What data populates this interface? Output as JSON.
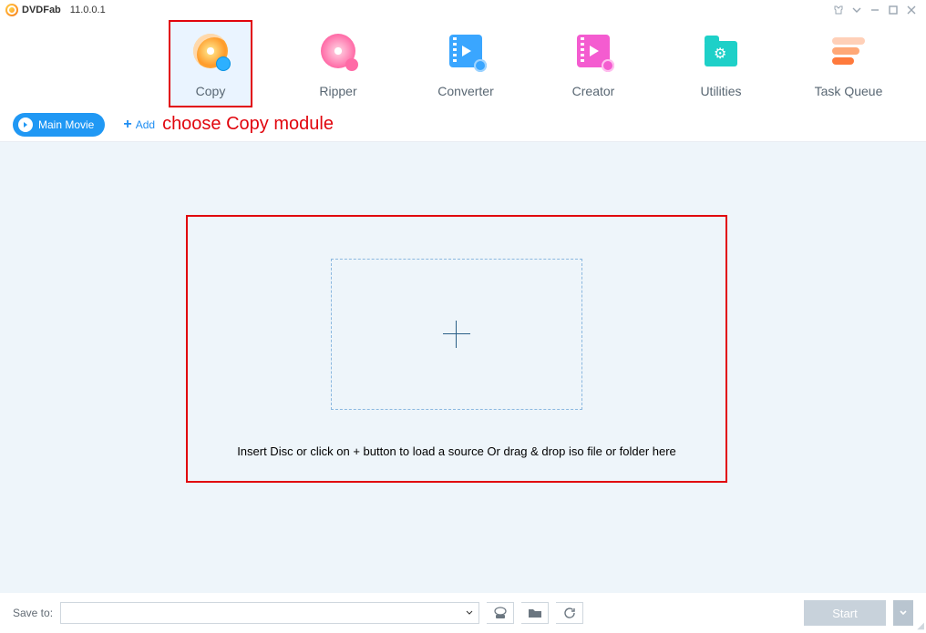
{
  "title": {
    "brand": "DVDFab",
    "version": "11.0.0.1"
  },
  "winControls": {
    "tshirt": "tshirt-icon",
    "dropdown": "chevron-down-icon",
    "minimize": "minimize-icon",
    "maximize": "maximize-icon",
    "close": "close-icon"
  },
  "tabs": {
    "items": [
      {
        "key": "copy",
        "label": "Copy"
      },
      {
        "key": "ripper",
        "label": "Ripper"
      },
      {
        "key": "converter",
        "label": "Converter"
      },
      {
        "key": "creator",
        "label": "Creator"
      },
      {
        "key": "utilities",
        "label": "Utilities"
      },
      {
        "key": "taskqueue",
        "label": "Task Queue"
      }
    ],
    "active": "copy"
  },
  "toolbar": {
    "mode_label": "Main Movie",
    "add_label": "Add",
    "annotation": "choose Copy module"
  },
  "dropzone": {
    "hint": "Insert Disc or click on + button to load a source Or drag & drop iso file or folder here"
  },
  "bottom": {
    "saveto_label": "Save to:",
    "combo_value": "",
    "start_label": "Start"
  },
  "colors": {
    "accent": "#2098f4",
    "annotation": "#e1050d",
    "content_bg": "#eef5fa"
  }
}
